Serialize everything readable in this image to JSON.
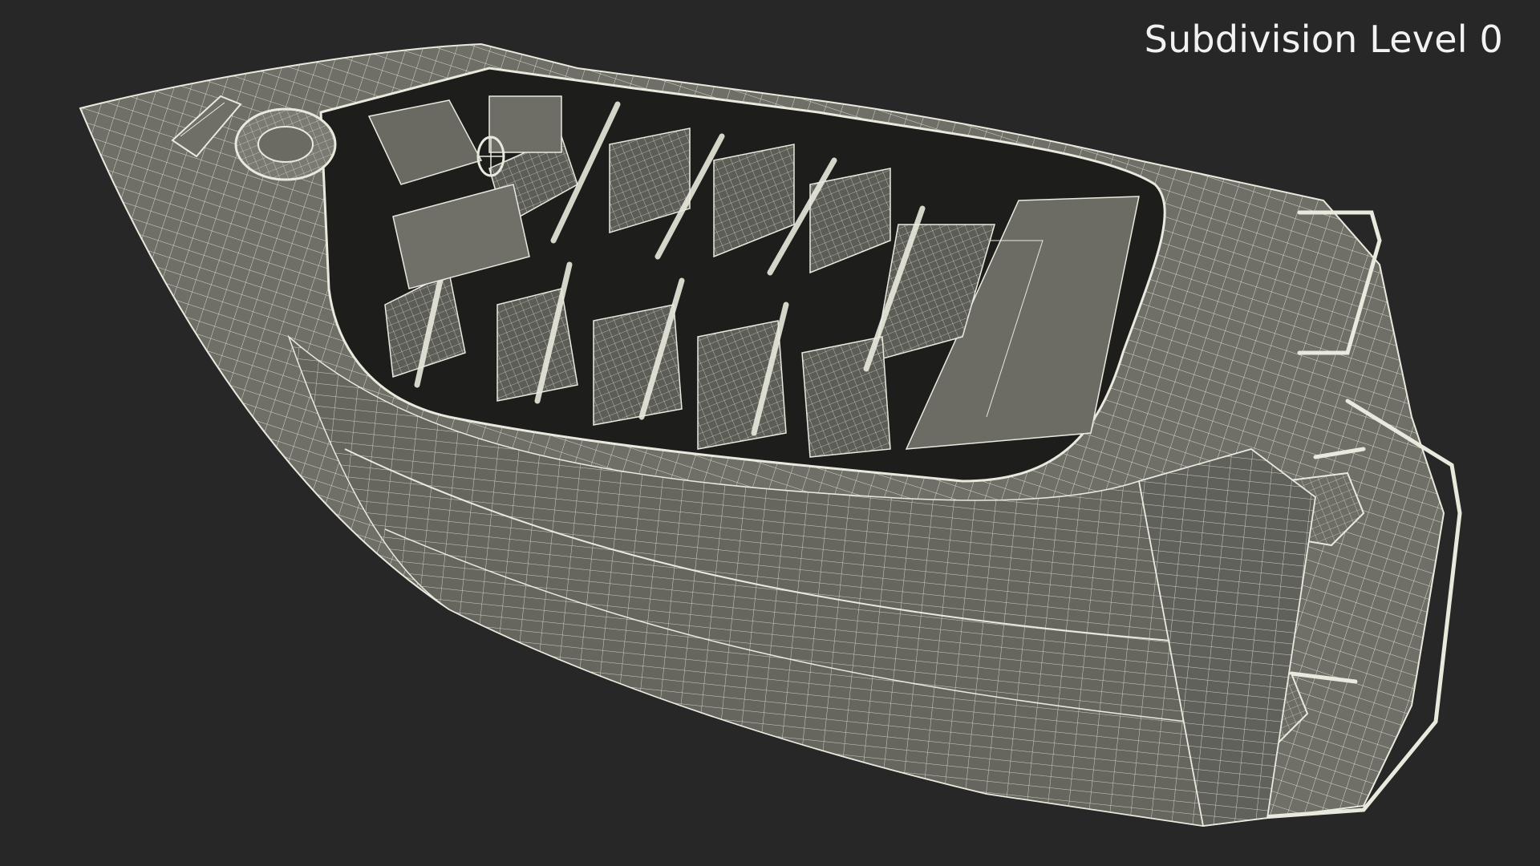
{
  "caption": "Subdivision Level 0",
  "colors": {
    "background": "#272727",
    "mesh_fill": "#6f6f68",
    "mesh_fill_dark": "#55554f",
    "interior": "#1a1b18",
    "wire": "#e9e9dd",
    "caption": "#f2f2f2"
  },
  "objects": {
    "boat": "wireframe-boat-model",
    "life_ring": "life-ring",
    "steering_wheel": "steering-wheel",
    "seats": "seat-rows",
    "railing": "stern-railing",
    "motors": "outboard-motors"
  }
}
